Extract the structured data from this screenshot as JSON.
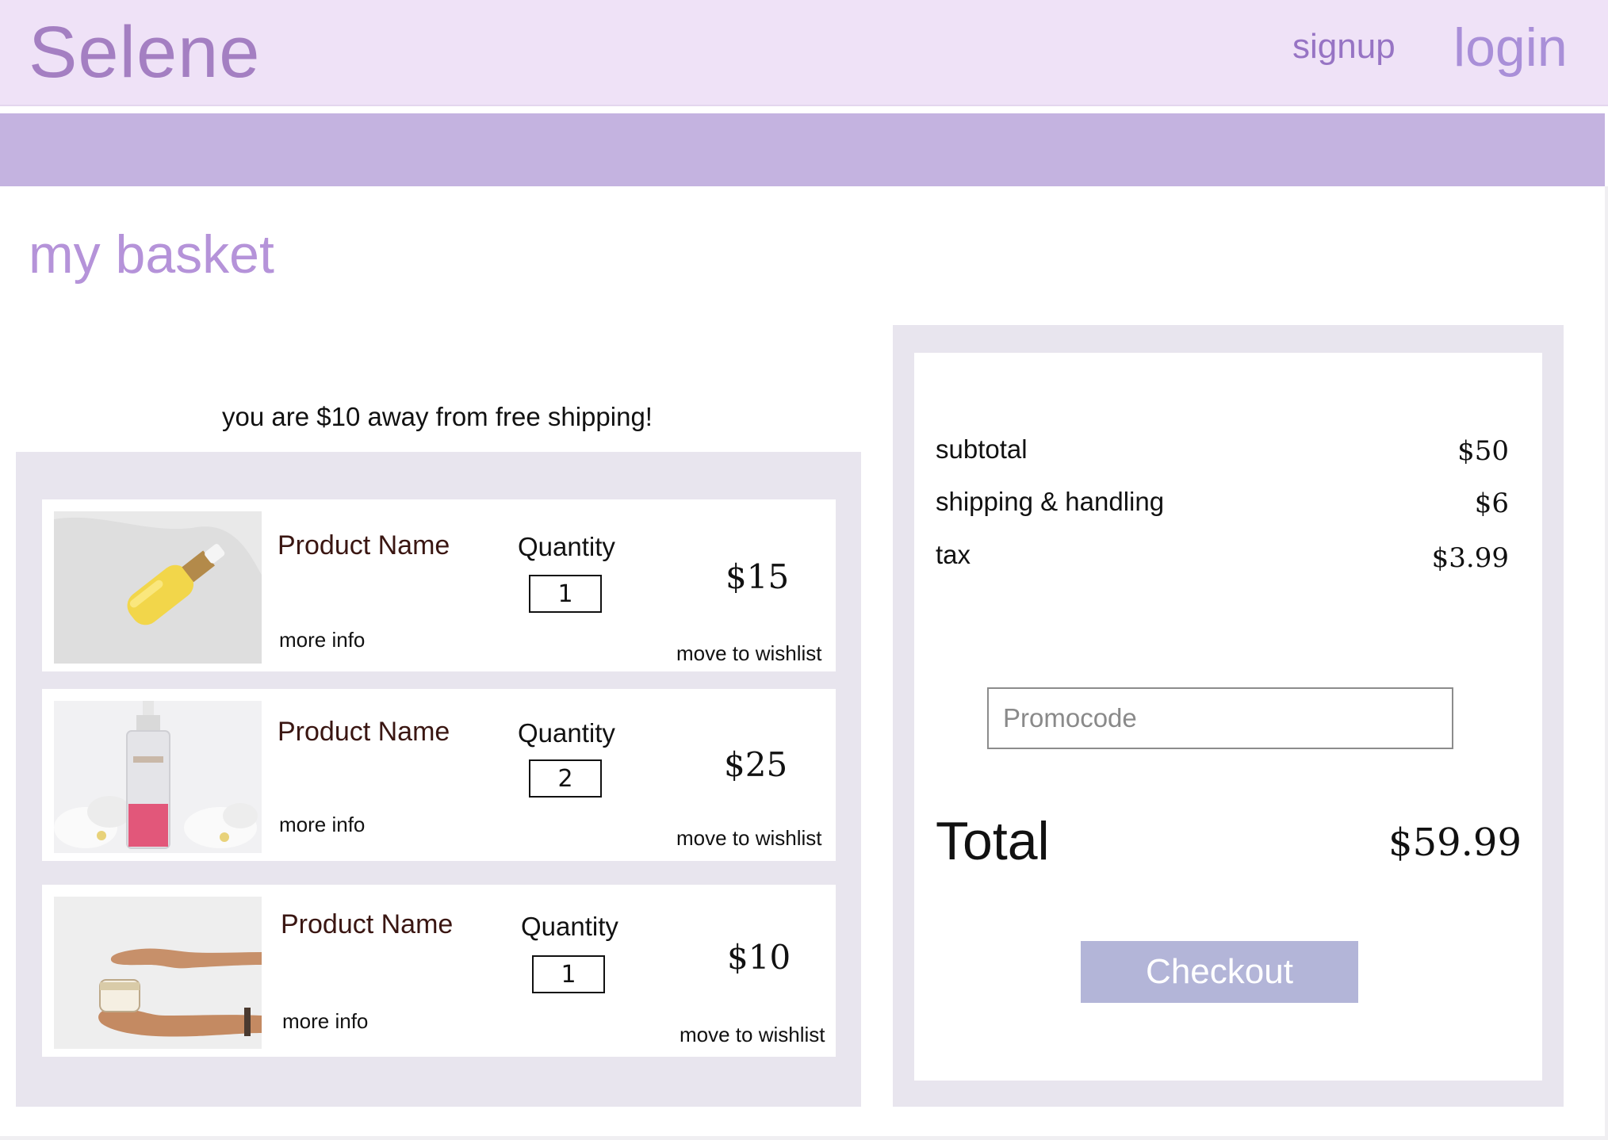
{
  "header": {
    "brand": "Selene",
    "signup_label": "signup",
    "login_label": "login"
  },
  "page": {
    "title": "my basket",
    "free_shipping_message": "you are $10 away from free shipping!"
  },
  "cart": {
    "items": [
      {
        "name": "Product Name",
        "more_info": "more info",
        "quantity_label": "Quantity",
        "quantity": "1",
        "price": "$15",
        "wishlist": "move to wishlist",
        "image": "yellow-serum-dropper-bottle"
      },
      {
        "name": "Product Name",
        "more_info": "more info",
        "quantity_label": "Quantity",
        "quantity": "2",
        "price": "$25",
        "wishlist": "move to wishlist",
        "image": "pink-cleansing-oil-pump-bottle"
      },
      {
        "name": "Product Name",
        "more_info": "more info",
        "quantity_label": "Quantity",
        "quantity": "1",
        "price": "$10",
        "wishlist": "move to wishlist",
        "image": "hands-applying-cream-jar"
      }
    ]
  },
  "summary": {
    "subtotal_label": "subtotal",
    "subtotal_value": "$50",
    "shipping_label": "shipping & handling",
    "shipping_value": "$6",
    "tax_label": "tax",
    "tax_value": "$3.99",
    "promo_placeholder": "Promocode",
    "total_label": "Total",
    "total_value": "$59.99",
    "checkout_label": "Checkout"
  },
  "colors": {
    "header_bg": "#efe2f7",
    "brand": "#a47fc2",
    "stripe": "#c4b3e0",
    "title": "#b593d9",
    "panel_bg": "#e8e5ee",
    "checkout_bg": "#b3b5d8"
  }
}
